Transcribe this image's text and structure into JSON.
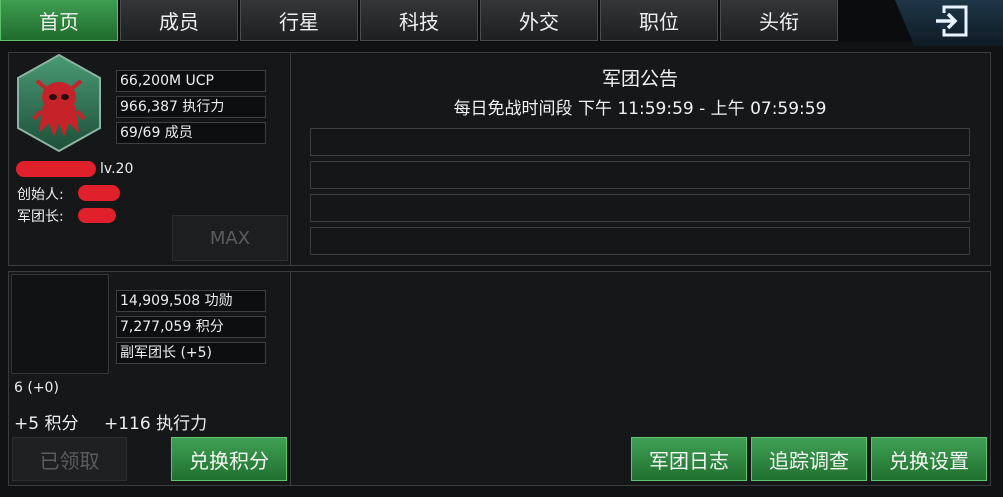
{
  "tabs": [
    {
      "label": "首页",
      "active": true
    },
    {
      "label": "成员",
      "active": false
    },
    {
      "label": "行星",
      "active": false
    },
    {
      "label": "科技",
      "active": false
    },
    {
      "label": "外交",
      "active": false
    },
    {
      "label": "职位",
      "active": false
    },
    {
      "label": "头衔",
      "active": false
    }
  ],
  "exit_icon": "exit-door-icon",
  "legion": {
    "ucp": "66,200M UCP",
    "execution": "966,387 执行力",
    "members": "69/69 成员",
    "level": "lv.20",
    "founder_label": "创始人:",
    "leader_label": "军团长:",
    "max_label": "MAX",
    "emblem_icon": "legion-emblem-icon"
  },
  "notice": {
    "title": "军团公告",
    "truce": "每日免战时间段 下午 11:59:59 - 上午 07:59:59",
    "lines": [
      "",
      "",
      "",
      ""
    ]
  },
  "player": {
    "merit": "14,909,508 功勋",
    "points": "7,277,059 积分",
    "position": "副军团长 (+5)",
    "count": "6 (+0)",
    "reward_points": "+5 积分",
    "reward_execution": "+116 执行力"
  },
  "buttons": {
    "claimed": "已领取",
    "exchange_points": "兑换积分",
    "legion_log": "军团日志",
    "track_investigate": "追踪调查",
    "exchange_settings": "兑换设置"
  },
  "colors": {
    "tab_active": "#2f8a42",
    "button_green": "#2f8a42",
    "redaction": "#e0202b"
  }
}
